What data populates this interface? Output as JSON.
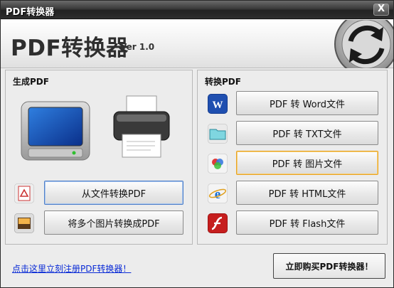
{
  "window": {
    "title": "PDF转换器",
    "close_label": "X"
  },
  "header": {
    "app_title": "PDF转换器",
    "version": "Ver 1.0"
  },
  "left_panel": {
    "title": "生成PDF",
    "buttons": [
      {
        "label": "从文件转换PDF",
        "icon": "pdf-file-icon"
      },
      {
        "label": "将多个图片转换成PDF",
        "icon": "image-icon"
      }
    ]
  },
  "right_panel": {
    "title": "转换PDF",
    "buttons": [
      {
        "label": "PDF 转 Word文件",
        "icon": "word-icon"
      },
      {
        "label": "PDF 转 TXT文件",
        "icon": "txt-folder-icon"
      },
      {
        "label": "PDF 转 图片文件",
        "icon": "picture-icon"
      },
      {
        "label": "PDF 转 HTML文件",
        "icon": "ie-icon"
      },
      {
        "label": "PDF 转 Flash文件",
        "icon": "flash-icon"
      }
    ]
  },
  "footer": {
    "register_link": "点击这里立刻注册PDF转换器！",
    "buy_button": "立即购买PDF转换器！"
  },
  "colors": {
    "link": "#0a2bd6",
    "focus_border": "#4f7fc8",
    "selected_border": "#e8a21f"
  }
}
